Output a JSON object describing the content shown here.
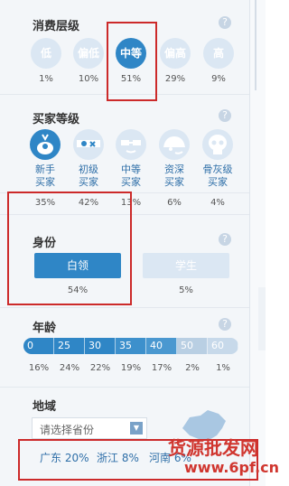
{
  "consumption": {
    "title": "消费层级",
    "help": "?",
    "items": [
      {
        "label": "低",
        "pct": "1%"
      },
      {
        "label": "偏低",
        "pct": "10%"
      },
      {
        "label": "中等",
        "pct": "51%"
      },
      {
        "label": "偏高",
        "pct": "29%"
      },
      {
        "label": "高",
        "pct": "9%"
      }
    ]
  },
  "buyer_level": {
    "title": "买家等级",
    "help": "?",
    "items": [
      {
        "line1": "新手",
        "line2": "买家",
        "pct": "35%"
      },
      {
        "line1": "初级",
        "line2": "买家",
        "pct": "42%"
      },
      {
        "line1": "中等",
        "line2": "买家",
        "pct": "13%"
      },
      {
        "line1": "资深",
        "line2": "买家",
        "pct": "6%"
      },
      {
        "line1": "骨灰级",
        "line2": "买家",
        "pct": "4%"
      }
    ]
  },
  "identity": {
    "title": "身份",
    "help": "?",
    "items": [
      {
        "label": "白领",
        "pct": "54%"
      },
      {
        "label": "学生",
        "pct": "5%"
      }
    ]
  },
  "age": {
    "title": "年龄",
    "help": "?",
    "segments": [
      {
        "label": "0",
        "pct": "16%"
      },
      {
        "label": "25",
        "pct": "24%"
      },
      {
        "label": "30",
        "pct": "22%"
      },
      {
        "label": "35",
        "pct": "19%"
      },
      {
        "label": "40",
        "pct": "17%"
      },
      {
        "label": "50",
        "pct": "2%"
      },
      {
        "label": "60",
        "pct": "1%"
      }
    ]
  },
  "region": {
    "title": "地域",
    "select_placeholder": "请选择省份",
    "items": [
      {
        "label": "广东 20%"
      },
      {
        "label": "浙江 8%"
      },
      {
        "label": "河南 6%"
      }
    ]
  },
  "watermark": {
    "line1": "货源批发网",
    "line2": "www.6pf.cn"
  },
  "colors": {
    "accent": "#2f86c6",
    "light": "#dbe7f3",
    "highlight_border": "#cc2a2a"
  }
}
